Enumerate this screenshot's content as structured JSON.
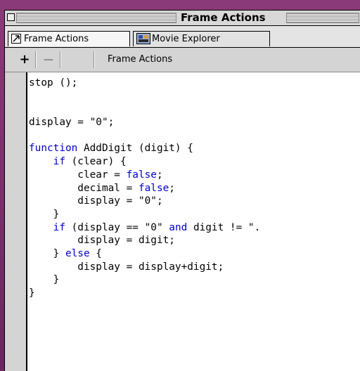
{
  "window": {
    "title": "Frame Actions"
  },
  "tabs": [
    {
      "label": "Frame Actions",
      "icon": "arrow-icon",
      "active": true
    },
    {
      "label": "Movie Explorer",
      "icon": "movie-explorer-icon",
      "active": false
    }
  ],
  "toolbar": {
    "add_label": "+",
    "remove_label": "—",
    "panel_label": "Frame Actions"
  },
  "code_lines": [
    [
      {
        "t": "stop ();"
      }
    ],
    [
      {
        "t": ""
      }
    ],
    [
      {
        "t": ""
      }
    ],
    [
      {
        "t": "display = \"0\";"
      }
    ],
    [
      {
        "t": ""
      }
    ],
    [
      {
        "t": "function",
        "c": "kw"
      },
      {
        "t": " AddDigit (digit) {"
      }
    ],
    [
      {
        "t": "    "
      },
      {
        "t": "if",
        "c": "kw"
      },
      {
        "t": " (clear) {"
      }
    ],
    [
      {
        "t": "        clear = "
      },
      {
        "t": "false",
        "c": "vl"
      },
      {
        "t": ";"
      }
    ],
    [
      {
        "t": "        decimal = "
      },
      {
        "t": "false",
        "c": "vl"
      },
      {
        "t": ";"
      }
    ],
    [
      {
        "t": "        display = \"0\";"
      }
    ],
    [
      {
        "t": "    }"
      }
    ],
    [
      {
        "t": "    "
      },
      {
        "t": "if",
        "c": "kw"
      },
      {
        "t": " (display == \"0\" "
      },
      {
        "t": "and",
        "c": "kw"
      },
      {
        "t": " digit != \"."
      }
    ],
    [
      {
        "t": "        display = digit;"
      }
    ],
    [
      {
        "t": "    } "
      },
      {
        "t": "else",
        "c": "kw"
      },
      {
        "t": " {"
      }
    ],
    [
      {
        "t": "        display = display+digit;"
      }
    ],
    [
      {
        "t": "    }"
      }
    ],
    [
      {
        "t": "}"
      }
    ]
  ],
  "colors": {
    "keyword": "#0000cc",
    "background_desktop": "#7a2f6a"
  }
}
